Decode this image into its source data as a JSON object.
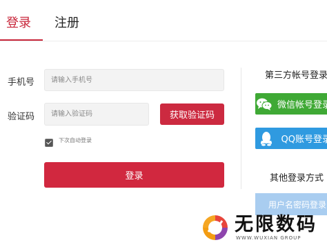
{
  "tabs": {
    "login": "登录",
    "register": "注册"
  },
  "form": {
    "phone_label": "手机号",
    "phone_placeholder": "请输入手机号",
    "code_label": "验证码",
    "code_placeholder": "请输入验证码",
    "get_code_label": "获取验证码",
    "remember_label": "下次自动登录",
    "remember_checked": true,
    "login_button": "登录"
  },
  "third_party": {
    "title": "第三方帐号登录",
    "wechat_label": "微信帐号登录",
    "qq_label": "QQ账号登录",
    "other_title": "其他登录方式",
    "password_login_label": "用户名密码登录"
  },
  "watermark": {
    "main": "无限数码",
    "sub": "WWW.WUXIAN GROUP"
  },
  "colors": {
    "accent": "#cc2a40",
    "wechat": "#3fa935",
    "qq": "#2f9ae0",
    "password_login": "#a9cdf0"
  }
}
